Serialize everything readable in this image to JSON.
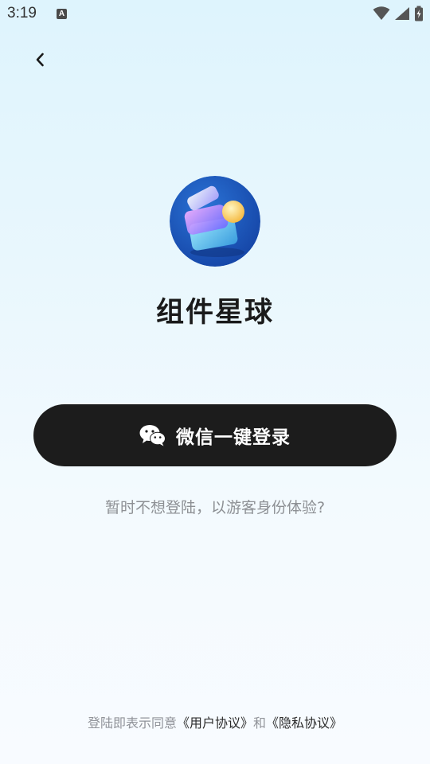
{
  "status_bar": {
    "time": "3:19",
    "notification_icon": "a-icon",
    "wifi_icon": "wifi-icon",
    "signal_icon": "signal-icon",
    "battery_icon": "battery-charging-icon"
  },
  "nav": {
    "back_icon": "chevron-left-icon"
  },
  "app": {
    "name": "组件星球",
    "logo_icon": "app-logo-icon"
  },
  "login": {
    "wechat_icon": "wechat-icon",
    "wechat_label": "微信一键登录",
    "guest_text": "暂时不想登陆，以游客身份体验?"
  },
  "agreement": {
    "prefix": "登陆即表示同意",
    "user_agreement": "《用户协议》",
    "conjunction": "和",
    "privacy_policy": "《隐私协议》"
  },
  "colors": {
    "button_bg": "#1c1c1c",
    "button_text": "#ffffff",
    "muted_text": "#8d9094",
    "logo_blue": "#1c5bc0"
  }
}
